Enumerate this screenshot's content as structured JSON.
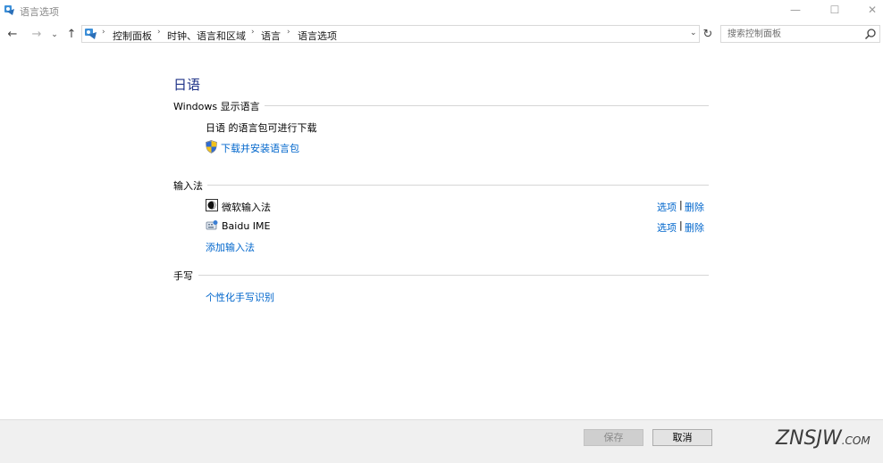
{
  "window": {
    "title": "语言选项",
    "controls": {
      "minimize": "—",
      "maximize": "☐",
      "close": "✕"
    }
  },
  "nav": {
    "back": "←",
    "forward": "→",
    "recent": "⌄",
    "up": "↑",
    "breadcrumb": [
      "控制面板",
      "时钟、语言和区域",
      "语言",
      "语言选项"
    ],
    "separator": "›",
    "dropdown": "⌄",
    "refresh": "↻"
  },
  "search": {
    "placeholder": "搜索控制面板",
    "value": ""
  },
  "page": {
    "title": "日语",
    "display_language": {
      "heading": "Windows 显示语言",
      "status": "日语 的语言包可进行下载",
      "download_link": "下载并安装语言包"
    },
    "input_method": {
      "heading": "输入法",
      "items": [
        {
          "name": "微软输入法",
          "options": "选项",
          "separator": "|",
          "remove": "删除"
        },
        {
          "name": "Baidu IME",
          "options": "选项",
          "separator": "|",
          "remove": "删除"
        }
      ],
      "add_link": "添加输入法"
    },
    "handwriting": {
      "heading": "手写",
      "personalize_link": "个性化手写识别"
    }
  },
  "footer": {
    "save": "保存",
    "cancel": "取消",
    "watermark": "ZNSJW",
    "watermark_suffix": ".COM"
  },
  "colors": {
    "link": "#0066cc",
    "title": "#1e3287",
    "footer_bg": "#f0f0f0"
  },
  "icons": [
    "app-icon",
    "control-panel-icon",
    "search-icon",
    "shield-icon",
    "microsoft-ime-icon",
    "baidu-ime-icon"
  ]
}
